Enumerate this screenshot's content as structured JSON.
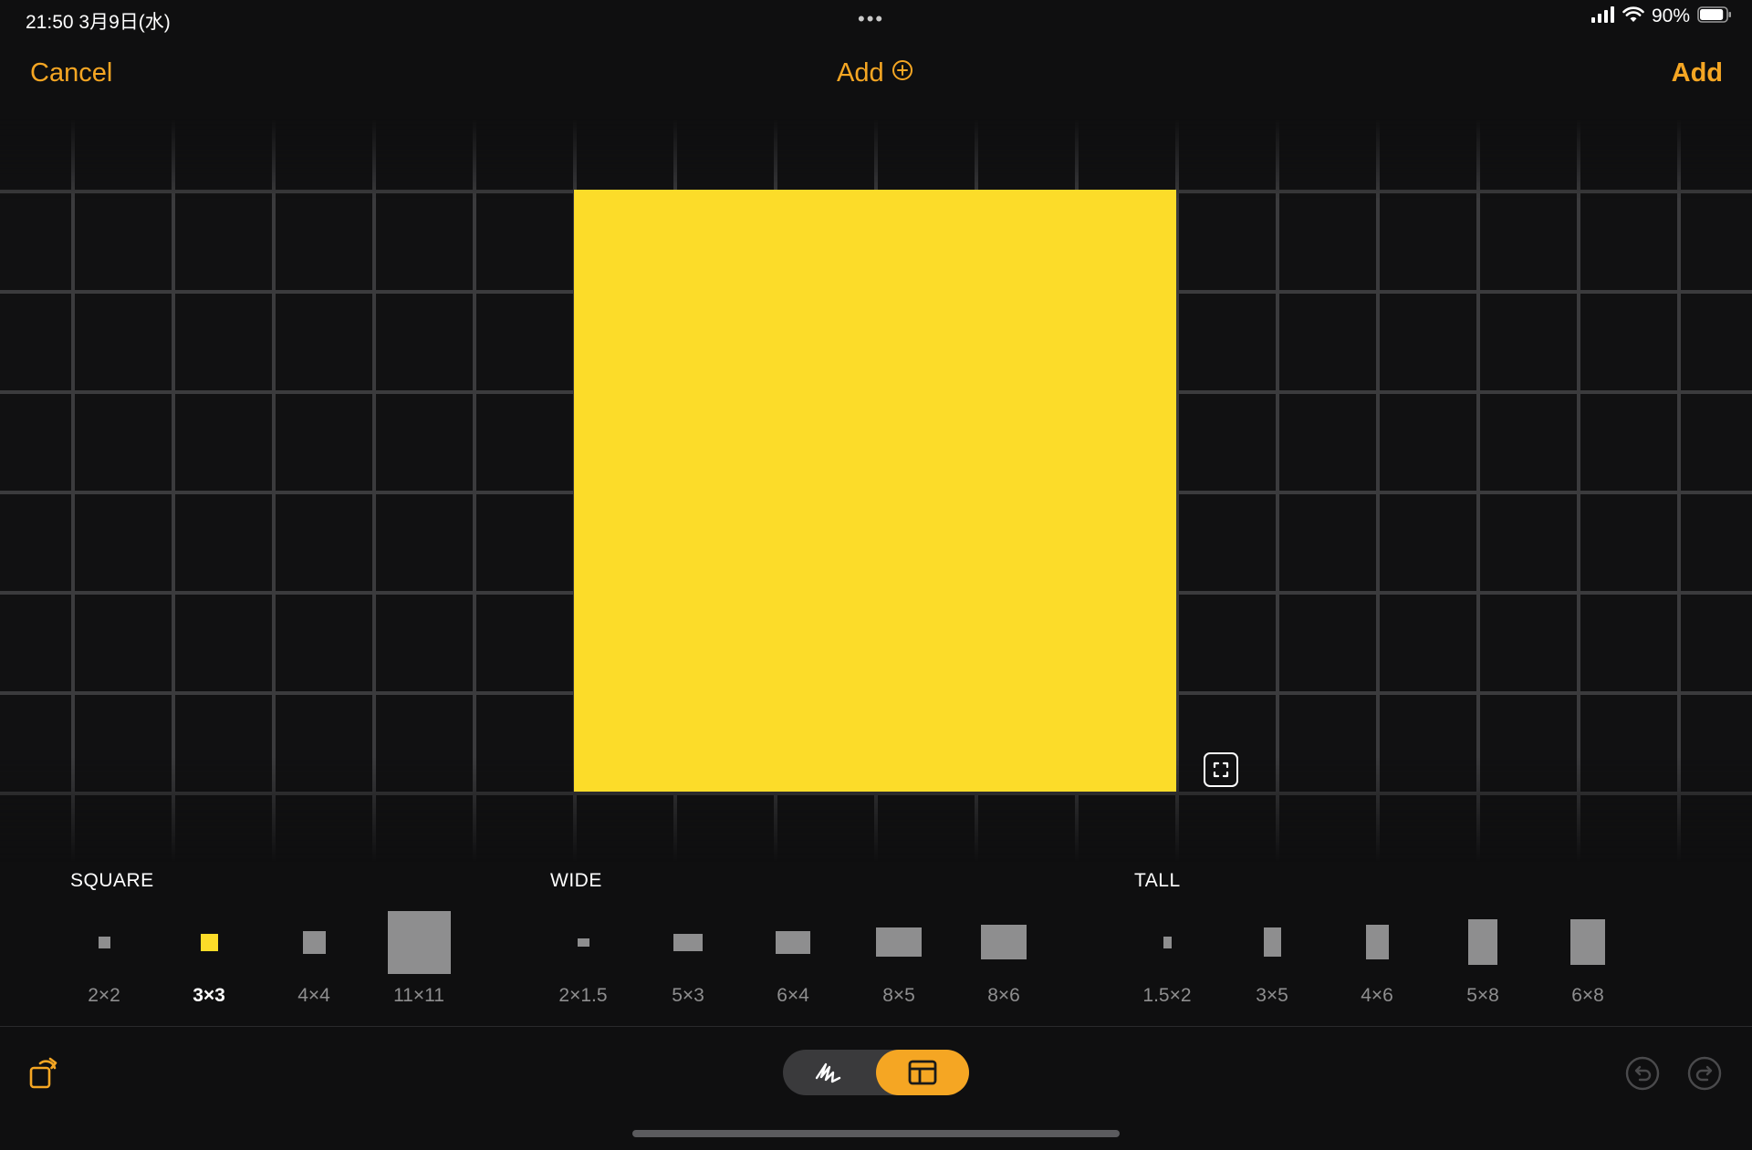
{
  "status_bar": {
    "time_date": "21:50  3月9日(水)",
    "battery_percent": "90%",
    "battery_level": 0.9,
    "icons": [
      "signal-icon",
      "wifi-icon",
      "battery-icon"
    ]
  },
  "nav": {
    "cancel_label": "Cancel",
    "title": "Add",
    "title_icon": "plus-circle-icon",
    "add_label": "Add"
  },
  "colors": {
    "accent": "#f5a623",
    "note": "#fcdc29",
    "swatch": "#8e8e8f",
    "background": "#0f0f10"
  },
  "canvas": {
    "note_color_name": "yellow",
    "resize_icon": "resize-icon"
  },
  "size_groups": [
    {
      "label": "SQUARE",
      "options": [
        {
          "label": "2×2",
          "ratio": [
            2,
            2
          ],
          "selected": false
        },
        {
          "label": "3×3",
          "ratio": [
            3,
            3
          ],
          "selected": true
        },
        {
          "label": "4×4",
          "ratio": [
            4,
            4
          ],
          "selected": false
        },
        {
          "label": "11×11",
          "ratio": [
            11,
            11
          ],
          "selected": false
        }
      ]
    },
    {
      "label": "WIDE",
      "options": [
        {
          "label": "2×1.5",
          "ratio": [
            2,
            1.5
          ],
          "selected": false
        },
        {
          "label": "5×3",
          "ratio": [
            5,
            3
          ],
          "selected": false
        },
        {
          "label": "6×4",
          "ratio": [
            6,
            4
          ],
          "selected": false
        },
        {
          "label": "8×5",
          "ratio": [
            8,
            5
          ],
          "selected": false
        },
        {
          "label": "8×6",
          "ratio": [
            8,
            6
          ],
          "selected": false
        }
      ]
    },
    {
      "label": "TALL",
      "options": [
        {
          "label": "1.5×2",
          "ratio": [
            1.5,
            2
          ],
          "selected": false
        },
        {
          "label": "3×5",
          "ratio": [
            3,
            5
          ],
          "selected": false
        },
        {
          "label": "4×6",
          "ratio": [
            4,
            6
          ],
          "selected": false
        },
        {
          "label": "5×8",
          "ratio": [
            5,
            8
          ],
          "selected": false
        },
        {
          "label": "6×8",
          "ratio": [
            6,
            8
          ],
          "selected": false
        }
      ]
    }
  ],
  "toolbar": {
    "rotate_icon": "rotate-icon",
    "mode_draw_icon": "pen-scribble-icon",
    "mode_layout_icon": "layout-icon",
    "active_mode": "layout",
    "undo_icon": "undo-icon",
    "redo_icon": "redo-icon"
  }
}
